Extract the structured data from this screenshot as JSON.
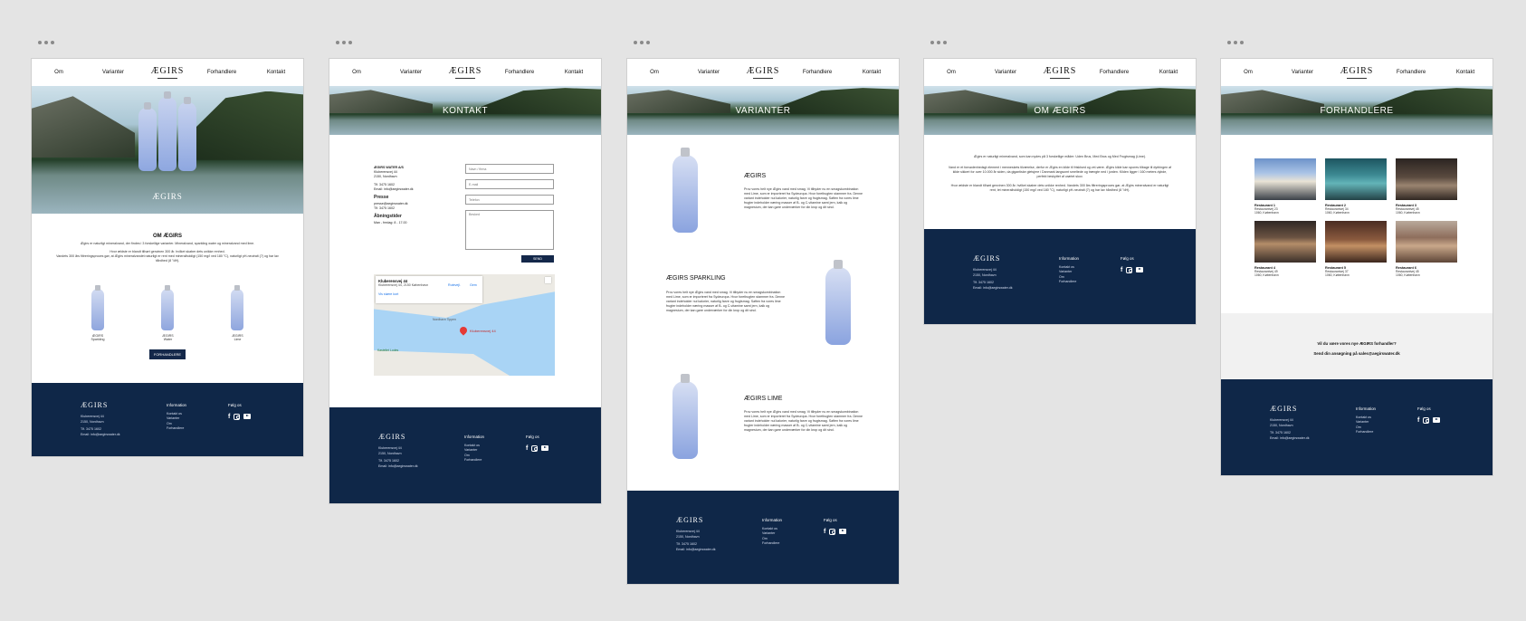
{
  "nav": {
    "om": "Om",
    "varianter": "Varianter",
    "logo": "ÆGIRS",
    "forhandlere": "Forhandlere",
    "kontakt": "Kontakt"
  },
  "footer": {
    "logo": "ÆGIRS",
    "address1": "Kluberensvej 44",
    "address2": "2150, Nordhavn",
    "phone": "Tlf. 3475 1602",
    "email": "Email: info@aegirswater.dk",
    "info_title": "Information",
    "links": [
      "Kontakt os",
      "Varianter",
      "Om",
      "Forhandlere"
    ],
    "follow_title": "Følg os",
    "social_icons": [
      "facebook-icon",
      "instagram-icon",
      "youtube-icon"
    ]
  },
  "home": {
    "hero_logo": "ÆGIRS",
    "title": "OM ÆGIRS",
    "text1": "Ægirs er naturligt mineralvand, der findes i 3 forskellige varianter. Mineralvand, sparkling water og mineralvand med lime.",
    "text2": "Hvor ældste er blandt tilhørt genvinen 300 år. hvilket skaber dets unikke renhed.",
    "text3": "Vandets 300 års filtreringsproces gør, at Ægirs mineralvandet naturligt er rent med mineralholdigt (150 mg/l ved 180 °C), naturligt pH-neutralt (7) og har lav hårdhed (8 °dH).",
    "bottles": [
      {
        "line1": "ÆGIRS",
        "line2": "Sparkling"
      },
      {
        "line1": "ÆGIRS",
        "line2": "Water"
      },
      {
        "line1": "ÆGIRS",
        "line2": "Lime"
      }
    ],
    "button": "FORHANDLERE"
  },
  "contact": {
    "hero_title": "KONTAKT",
    "company": "ÆGIRS WATER A/S",
    "street": "Kluberensvej 44",
    "city": "2150, Nordhavn",
    "phone": "Tlf. 3475 1602",
    "email": "Email: info@aegirswater.dk",
    "press_title": "Presse",
    "press_email": "presse@aegirswater.dk",
    "press_phone": "Tlf. 3475 1602",
    "hours_title": "Åbningstider",
    "hours": "Man - fredag: 8 - 17.00",
    "placeholders": {
      "name": "Navn / firma",
      "email": "E-mail",
      "phone": "Telefon",
      "message": "Besked"
    },
    "send": "SEND",
    "map": {
      "place": "Kluberensvej 44",
      "address": "Kluberensvej 44, 2150 København",
      "route": "Rutevejl.",
      "save": "Gem",
      "larger": "Vis større kort",
      "pin": "Kluberensvej 44",
      "poi1": "Nordhavn Tippen",
      "poi2": "Kastellet Lodes"
    }
  },
  "varianter": {
    "hero_title": "VARIANTER",
    "items": [
      {
        "title": "ÆGIRS",
        "text": "Prov vores helt nye Ægirs vand med smag. Vi tilbyder nu en smagskombination med Lime, som er importeret fra Sydeuropa. Hvor forethugten stammer fra. Denne variant indeholder nul kalorier, naturlig farve og frugtsmag. Saften fra vores lime frugter indeholder næring masser af B- og C-vitamine samt jern, kalk og magnesium, der kan gøre underværker for din krop og dit sind."
      },
      {
        "title": "ÆGIRS SPARKLING",
        "text": "Prov vores helt nye Ægirs vand med smag. Vi tilbyder nu en smagskombination med Lime, som er importeret fra Sydeuropa. Hvor forethugten stammer fra. Denne variant indeholder nul kalorier, naturlig farve og frugtsmag. Saften fra vores lime frugter indeholder næring masser af B- og C-vitamine samt jern, kalk og magnesium, der kan gøre underværker for din krop og dit sind."
      },
      {
        "title": "ÆGIRS LIME",
        "text": "Prov vores helt nye Ægirs vand med smag. Vi tilbyder nu en smagskombination med Lime, som er importeret fra Sydeuropa. Hvor forethugten stammer fra. Denne variant indeholder nul kalorier, naturlig farve og frugtsmag. Saften fra vores lime frugter indeholder næring masser af B- og C-vitamine samt jern, kalk og magnesium, der kan gøre underværker for din krop og dit sind."
      }
    ]
  },
  "om": {
    "hero_title": "OM ÆGIRS",
    "p1": "Ægirs er naturligt mineralvand, som kan nydes på 3 forskellige måder: Uden Brus, Med Brus og Med Frugtsmag (Lime).",
    "p2": "Vand er et fornødenhedsgt element i menneskets tilværelse, derfor er Ægirs en kilde til frisklsed og vel-være. Ægirs kilde kan spores tilbage til dyrbingen af kilde sikkert for over 10.000 år siden, da gigantiske gletsjere i Danmark langsomt smeltede og trængte ned i jorden. Kilden ligger i 160 meters dybde, perfekt beskyttet af urørtet skov.",
    "p3": "Hvor ældste er blandt tilhørt genvinen 300 år. hvilket skaber dets unikke renhed. Vandets 300 års filtreringsproces gør, at Ægirs mineralvand er naturligt rent, let mineralholdigt (150 mg/l ved 180 °C), naturligt pH-neutralt (7) og har lav hårdhed (8 °dH)."
  },
  "forhandlere": {
    "hero_title": "FORHANDLERE",
    "stores": [
      {
        "name": "Restaurant 1",
        "street": "Restaurantvej 23",
        "city": "1060, København"
      },
      {
        "name": "Restaurant 2",
        "street": "Restaurantvej 34",
        "city": "1060, København"
      },
      {
        "name": "Restaurant 3",
        "street": "Restaurantvej 45",
        "city": "1060, København"
      },
      {
        "name": "Restaurant 4",
        "street": "Restaurantvej 49",
        "city": "1060, København"
      },
      {
        "name": "Restaurant 5",
        "street": "Restaurantvej 37",
        "city": "1060, København"
      },
      {
        "name": "Restaurant 6",
        "street": "Restaurantvej 45",
        "city": "1060, København"
      }
    ],
    "cta1": "Vil du være vores nye ÆGIRS forhandler?",
    "cta2": "Send din ansøgning på sales@aegirswater.dk"
  },
  "colors": {
    "navy": "#0f2748",
    "bottle": "#8fa6de",
    "background": "#e4e4e4"
  }
}
